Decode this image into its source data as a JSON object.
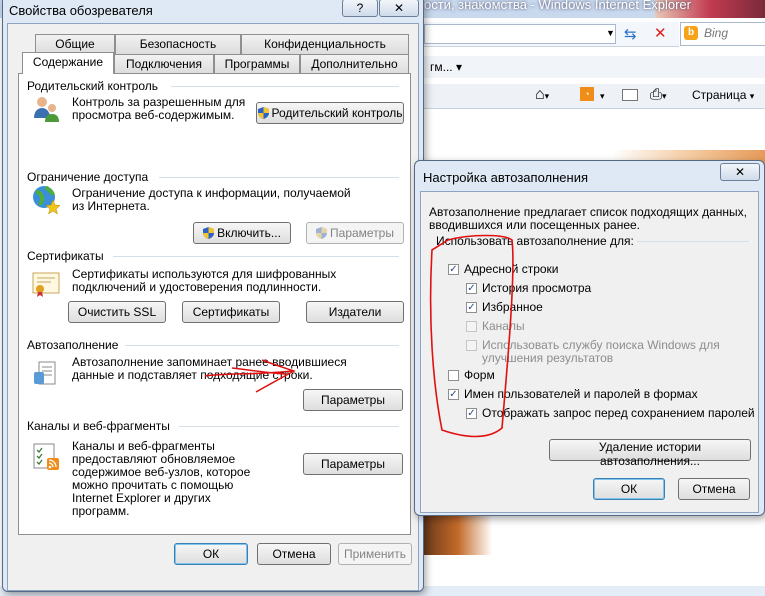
{
  "browser": {
    "title": "ости, знакомства - Windows Internet Explorer",
    "search_placeholder": "Bing",
    "favorites_text": "гм... ▾",
    "page_menu": "Страница"
  },
  "internet_options": {
    "title": "Свойства обозревателя",
    "help_button": "?",
    "tabs_row1": [
      "Общие",
      "Безопасность",
      "Конфиденциальность"
    ],
    "tabs_row2": [
      "Содержание",
      "Подключения",
      "Программы",
      "Дополнительно"
    ],
    "active_tab": "Содержание",
    "parental": {
      "label": "Родительский контроль",
      "text": "Контроль за разрешенным для просмотра веб-содержимым.",
      "button": "Родительский контроль"
    },
    "content_advisor": {
      "label": "Ограничение доступа",
      "text": "Ограничение доступа к информации, получаемой из Интернета.",
      "enable_button": "Включить...",
      "settings_button": "Параметры"
    },
    "certificates": {
      "label": "Сертификаты",
      "text": "Сертификаты используются для шифрованных подключений и удостоверения подлинности.",
      "clear_ssl_button": "Очистить SSL",
      "certificates_button": "Сертификаты",
      "publishers_button": "Издатели"
    },
    "autocomplete": {
      "label": "Автозаполнение",
      "text": "Автозаполнение запоминает ранее вводившиеся данные и подставляет подходящие строки.",
      "settings_button": "Параметры"
    },
    "feeds": {
      "label": "Каналы и веб-фрагменты",
      "text": "Каналы и веб-фрагменты предоставляют обновляемое содержимое веб-узлов, которое можно прочитать с помощью Internet Explorer и других программ.",
      "settings_button": "Параметры"
    },
    "ok_button": "ОК",
    "cancel_button": "Отмена",
    "apply_button": "Применить"
  },
  "autocomplete_settings": {
    "title": "Настройка автозаполнения",
    "close_button": "✕",
    "intro": "Автозаполнение предлагает список подходящих данных, вводившихся или посещенных ранее.",
    "group_label": "Использовать автозаполнение для:",
    "options": [
      {
        "label": "Адресной строки",
        "checked": true,
        "enabled": true
      },
      {
        "label": "История просмотра",
        "checked": true,
        "enabled": true
      },
      {
        "label": "Избранное",
        "checked": true,
        "enabled": true
      },
      {
        "label": "Каналы",
        "checked": false,
        "enabled": false
      },
      {
        "label": "Использовать службу поиска Windows для улучшения результатов",
        "checked": false,
        "enabled": false
      },
      {
        "label": "Форм",
        "checked": false,
        "enabled": true
      },
      {
        "label": "Имен пользователей и паролей в формах",
        "checked": true,
        "enabled": true
      },
      {
        "label": "Отображать запрос перед сохранением паролей",
        "checked": true,
        "enabled": true
      }
    ],
    "delete_history_button": "Удаление истории автозаполнения...",
    "ok_button": "ОК",
    "cancel_button": "Отмена"
  },
  "colors": {
    "annotation_red": "#e01010",
    "checkmark": "#2b4b8a"
  }
}
